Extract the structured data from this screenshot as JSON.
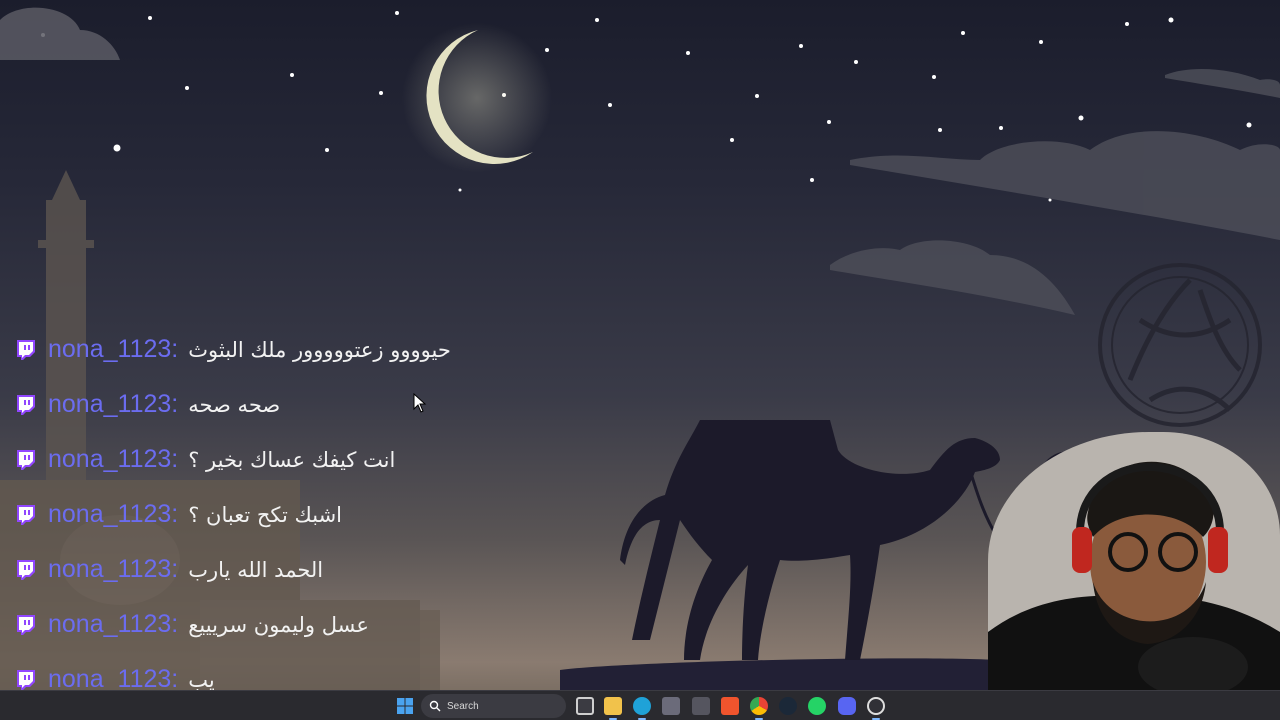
{
  "stream": {
    "platform_icon": "twitch-icon",
    "chat_messages": [
      {
        "username": "nona_1123",
        "separator": ":",
        "text": "حيوووو زعتووووور ملك البثوث"
      },
      {
        "username": "nona_1123",
        "separator": ":",
        "text": "صحه صحه"
      },
      {
        "username": "nona_1123",
        "separator": ":",
        "text": "انت كيفك عساك بخير ؟"
      },
      {
        "username": "nona_1123",
        "separator": ":",
        "text": "اشبك تكح تعبان ؟"
      },
      {
        "username": "nona_1123",
        "separator": ":",
        "text": "الحمد الله يارب"
      },
      {
        "username": "nona_1123",
        "separator": ":",
        "text": "عسل وليمون سريييع"
      },
      {
        "username": "nona_1123",
        "separator": ":",
        "text": "يب"
      }
    ]
  },
  "taskbar": {
    "search_placeholder": "Search",
    "icons": [
      "windows-start-icon",
      "task-view-icon",
      "file-explorer-icon",
      "edge-icon",
      "store-icon",
      "app-icon",
      "brave-icon",
      "chrome-icon",
      "steam-icon",
      "whatsapp-icon",
      "discord-icon",
      "obs-icon"
    ],
    "colors": {
      "accent": "#6b6cf0",
      "twitch": "#9146ff"
    }
  }
}
